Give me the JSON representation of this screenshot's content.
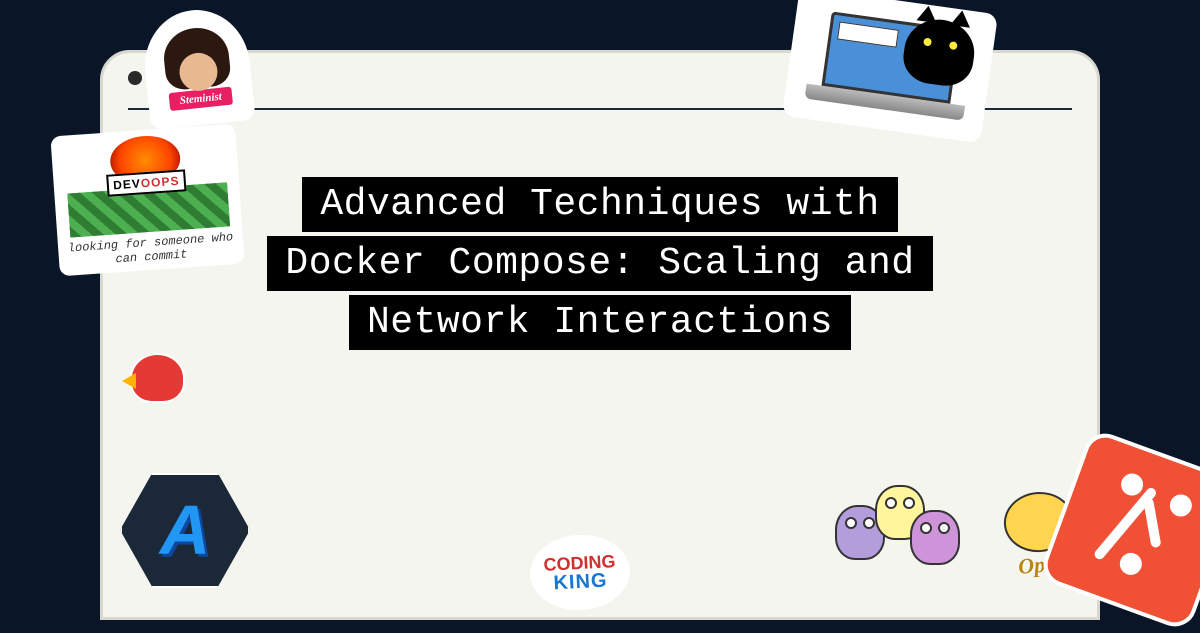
{
  "title": {
    "line1": "Advanced Techniques with",
    "line2": "Docker Compose: Scaling and",
    "line3": "Network Interactions"
  },
  "stickers": {
    "steminist": {
      "label": "Steminist"
    },
    "devoops": {
      "label_dev": "DEV",
      "label_oops": "OOPS",
      "tagline": "looking for someone who can commit"
    },
    "coding_king": {
      "top": "CODING",
      "bottom": "KING"
    },
    "open": {
      "label": "Open"
    }
  },
  "colors": {
    "background": "#0a1628",
    "title_bg": "#000000",
    "title_fg": "#ffffff",
    "git_orange": "#f05033"
  }
}
